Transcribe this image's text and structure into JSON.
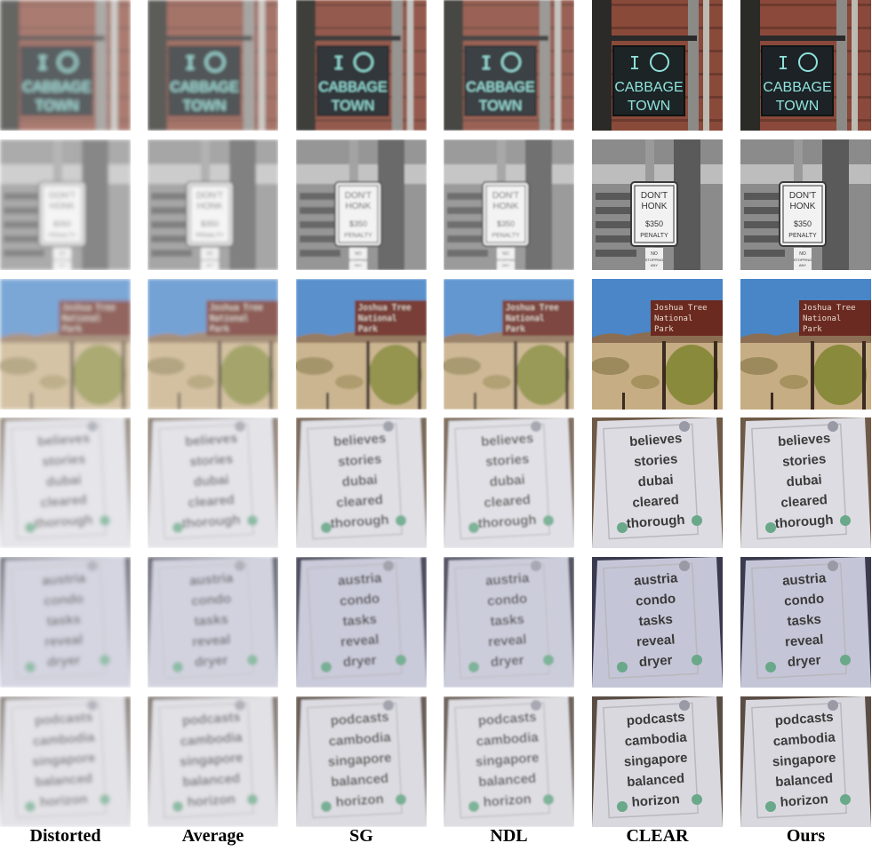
{
  "columns": [
    {
      "label": "Distorted"
    },
    {
      "label": "Average"
    },
    {
      "label": "SG"
    },
    {
      "label": "NDL"
    },
    {
      "label": "CLEAR"
    },
    {
      "label": "Ours"
    }
  ],
  "rows": [
    {
      "scene": "cabbage-town-sign",
      "sign_lines": [
        "I",
        "CABBAGE",
        "TOWN"
      ]
    },
    {
      "scene": "dont-honk-sign",
      "sign_lines": [
        "DON'T",
        "HONK",
        "$350",
        "PENALTY",
        "NO",
        "STOPPING",
        "ANY"
      ]
    },
    {
      "scene": "joshua-tree-sign",
      "sign_lines": [
        "Joshua Tree",
        "National",
        "Park"
      ]
    },
    {
      "scene": "word-card-1",
      "sign_lines": [
        "believes",
        "stories",
        "dubai",
        "cleared",
        "thorough"
      ]
    },
    {
      "scene": "word-card-2",
      "sign_lines": [
        "austria",
        "condo",
        "tasks",
        "reveal",
        "dryer"
      ]
    },
    {
      "scene": "word-card-3",
      "sign_lines": [
        "podcasts",
        "cambodia",
        "singapore",
        "balanced",
        "horizon"
      ]
    }
  ],
  "column_quality": [
    {
      "blur": 2.2,
      "contrast": 0.72
    },
    {
      "blur": 1.9,
      "contrast": 0.76
    },
    {
      "blur": 1.0,
      "contrast": 0.9
    },
    {
      "blur": 1.1,
      "contrast": 0.86
    },
    {
      "blur": 0.0,
      "contrast": 1.0
    },
    {
      "blur": 0.2,
      "contrast": 1.0
    }
  ],
  "colors": {
    "cabbage_text": "#8fe3dc",
    "cabbage_board": "#1c2426",
    "brick": "#8a4a3a",
    "honk_board": "#f2f2f2",
    "sky": "#4a86c8",
    "park_sign": "#6b2a20",
    "card_face_1": "#dcdce2",
    "card_face_2": "#c4c5d6",
    "card_face_3": "#d9d8de",
    "card_text": "#3a3a3a",
    "pin_green": "#6aa88a"
  }
}
